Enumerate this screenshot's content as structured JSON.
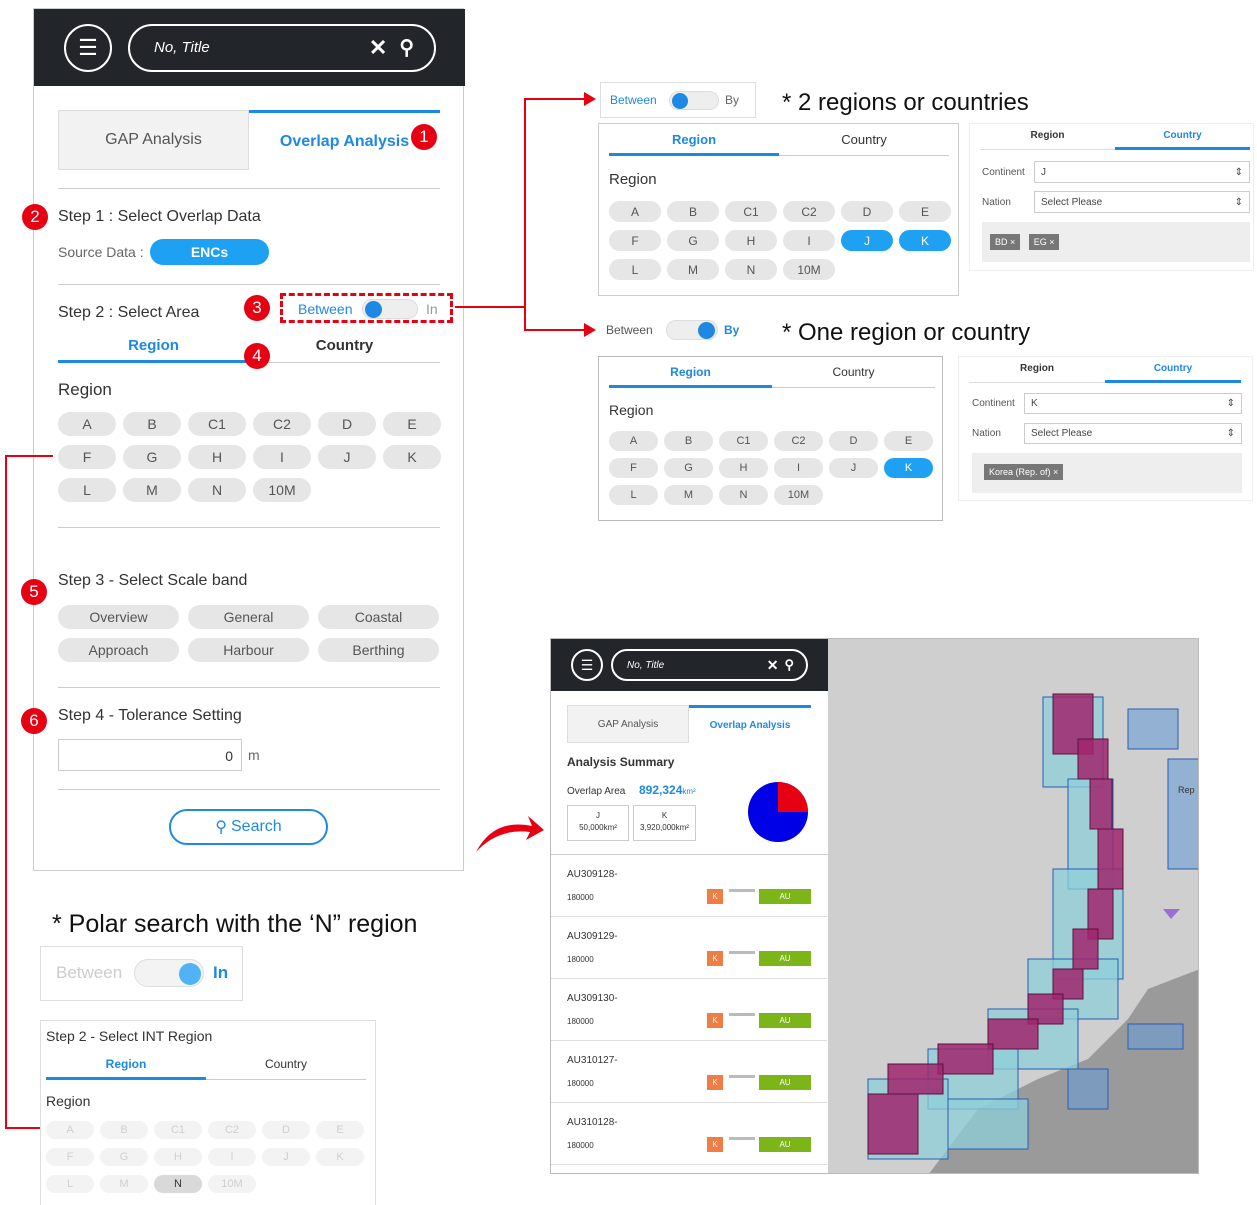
{
  "left_panel": {
    "search_placeholder": "No, Title",
    "tabs": [
      "GAP Analysis",
      "Overlap Analysis"
    ],
    "step1_title": "Step 1 : Select Overlap Data",
    "source_label": "Source Data :",
    "source_value": "ENCs",
    "step2_title": "Step 2 : Select Area",
    "toggle_left": "Between",
    "toggle_right": "In",
    "area_tabs": [
      "Region",
      "Country"
    ],
    "region_heading": "Region",
    "regions": [
      "A",
      "B",
      "C1",
      "C2",
      "D",
      "E",
      "F",
      "G",
      "H",
      "I",
      "J",
      "K",
      "L",
      "M",
      "N",
      "10M"
    ],
    "step3_title": "Step 3 - Select Scale band",
    "scale_bands": [
      "Overview",
      "General",
      "Coastal",
      "Approach",
      "Harbour",
      "Berthing"
    ],
    "step4_title": "Step 4 - Tolerance Setting",
    "tolerance_value": "0",
    "tolerance_unit": "m",
    "search_button": "Search"
  },
  "badges": [
    "1",
    "2",
    "3",
    "4",
    "5",
    "6"
  ],
  "example_between_by": {
    "caption": "* 2 regions or countries",
    "toggle_left": "Between",
    "toggle_right": "By",
    "tabs": [
      "Region",
      "Country"
    ],
    "region_heading": "Region",
    "selected_regions": [
      "J",
      "K"
    ],
    "country_tabs": [
      "Region",
      "Country"
    ],
    "continent_label": "Continent",
    "continent_value": "J",
    "nation_label": "Nation",
    "nation_value": "Select Please",
    "chips": [
      "BD ×",
      "EG ×"
    ]
  },
  "example_one": {
    "caption": "* One region or country",
    "toggle_left": "Between",
    "toggle_right": "By",
    "tabs": [
      "Region",
      "Country"
    ],
    "region_heading": "Region",
    "selected_regions": [
      "K"
    ],
    "country_tabs": [
      "Region",
      "Country"
    ],
    "continent_label": "Continent",
    "continent_value": "K",
    "nation_label": "Nation",
    "nation_value": "Select Please",
    "chips": [
      "Korea (Rep. of) ×"
    ]
  },
  "polar": {
    "caption": "* Polar search with the ‘N” region",
    "toggle_left": "Between",
    "toggle_right": "In",
    "step_title": "Step 2 - Select INT Region",
    "tabs": [
      "Region",
      "Country"
    ],
    "region_heading": "Region",
    "selected_regions": [
      "N"
    ]
  },
  "result_panel": {
    "search_placeholder": "No, Title",
    "tabs": [
      "GAP Analysis",
      "Overlap Analysis"
    ],
    "summary_title": "Analysis Summary",
    "overlap_label": "Overlap Area",
    "overlap_value": "892,324",
    "overlap_unit": "km²",
    "areas": [
      {
        "name": "J",
        "value": "50,000km²"
      },
      {
        "name": "K",
        "value": "3,920,000km²"
      }
    ],
    "pie_share_k": 0.25,
    "results": [
      {
        "id": "AU309128-",
        "scale": "180000",
        "from": "K",
        "to": "AU"
      },
      {
        "id": "AU309129-",
        "scale": "180000",
        "from": "K",
        "to": "AU"
      },
      {
        "id": "AU309130-",
        "scale": "180000",
        "from": "K",
        "to": "AU"
      },
      {
        "id": "AU310127-",
        "scale": "180000",
        "from": "K",
        "to": "AU"
      },
      {
        "id": "AU310128-",
        "scale": "180000",
        "from": "K",
        "to": "AU"
      }
    ],
    "map_label": "Rep"
  },
  "colors": {
    "accent": "#1e88e5",
    "badge": "#e60012",
    "header": "#222529",
    "overlap": "#a0266f",
    "green": "#7cb518",
    "orange": "#ef7d45"
  }
}
